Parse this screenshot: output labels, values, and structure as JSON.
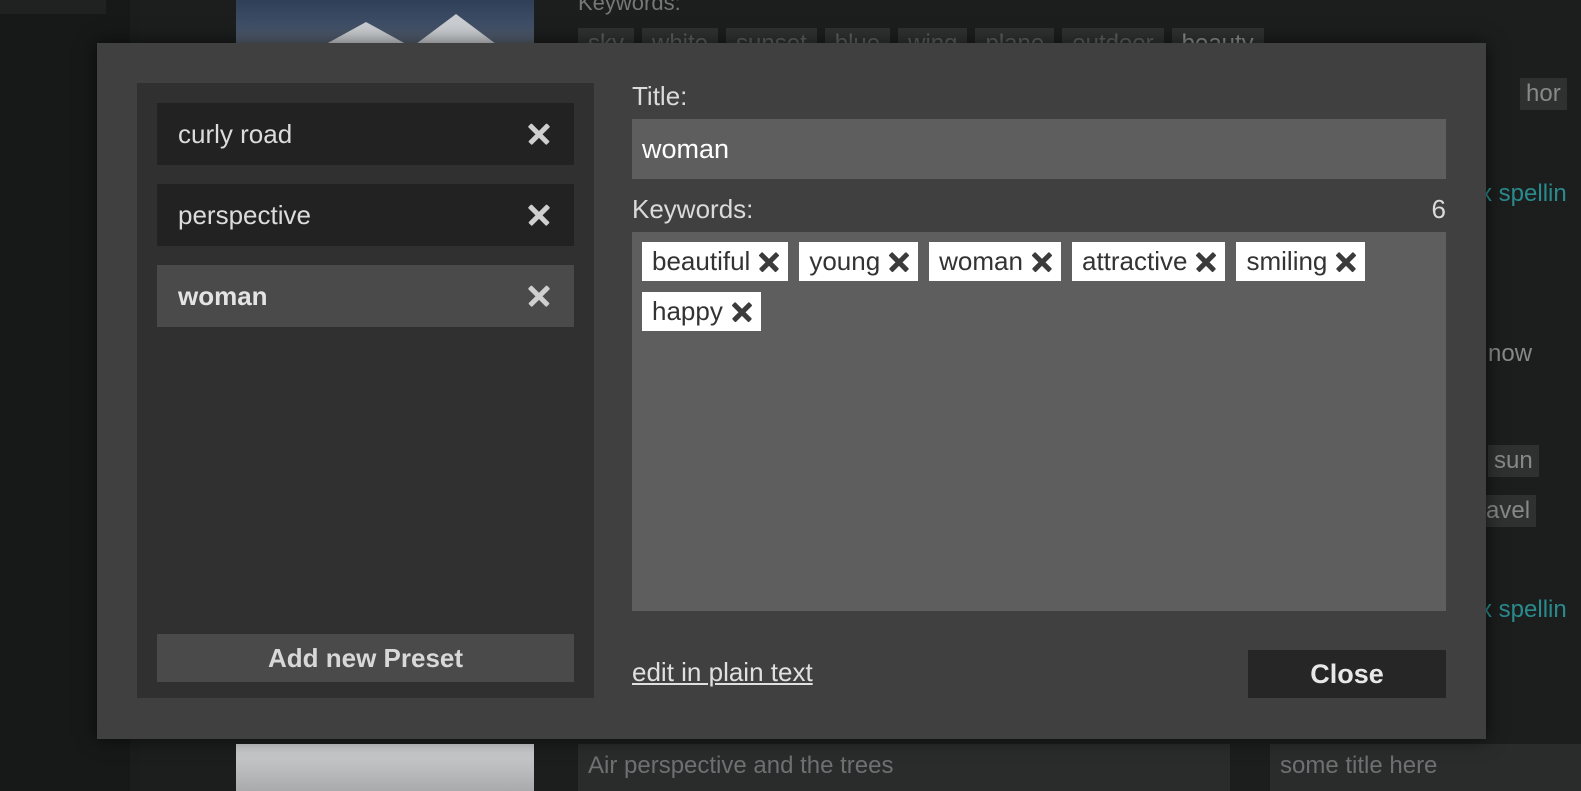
{
  "background": {
    "keywords_heading": "Keywords:",
    "top_tags": [
      "sky",
      "white",
      "sunset",
      "blue",
      "wing",
      "plane",
      "outdoor",
      "beauty"
    ],
    "right_fragments": {
      "tag_row2": "hor",
      "spelling_link_1": "x spellin",
      "snow_text": "now",
      "sun_tag": "sun",
      "travel_tag": "avel",
      "spelling_link_2": "x spellin"
    },
    "bottom_description": "Air perspective and the trees",
    "bottom_title": "some title here"
  },
  "presets": {
    "items": [
      {
        "label": "curly road",
        "active": false
      },
      {
        "label": "perspective",
        "active": false
      },
      {
        "label": "woman",
        "active": true
      }
    ],
    "add_button_label": "Add new Preset"
  },
  "editor": {
    "title_label": "Title:",
    "title_value": "woman",
    "keywords_label": "Keywords:",
    "keywords_count": "6",
    "keywords": [
      "beautiful",
      "young",
      "woman",
      "attractive",
      "smiling",
      "happy"
    ],
    "plain_text_link": "edit in plain text",
    "close_label": "Close"
  }
}
